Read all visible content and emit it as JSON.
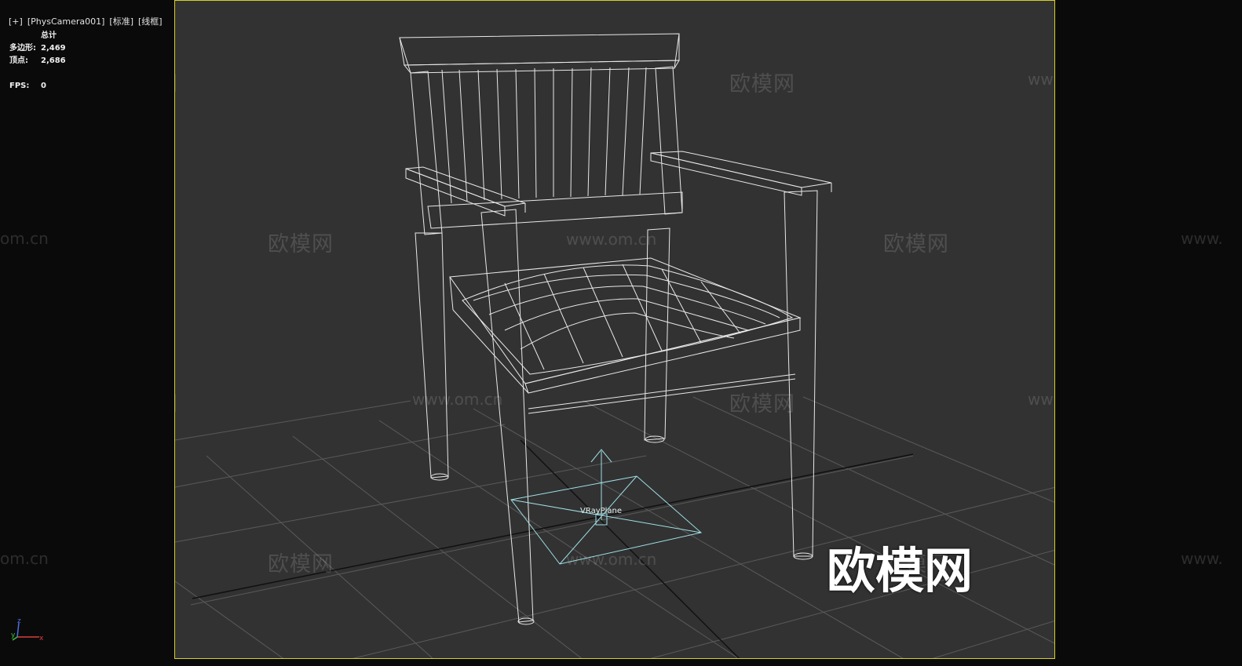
{
  "viewport_label": [
    "[+]",
    "[PhysCamera001]",
    "[标准]",
    "[线框]"
  ],
  "stats": {
    "header": "总计",
    "polygons_label": "多边形:",
    "polygons": "2,469",
    "vertices_label": "顶点:",
    "vertices": "2,686",
    "fps_label": "FPS:",
    "fps": "0"
  },
  "scene": {
    "object_label": "VRayPlane",
    "helper_color": "#9fe0e6",
    "wire_color": "#e8e8e8",
    "grid_color": "#5a5a5a",
    "viewport_border_color": "#d6cf25"
  },
  "axis": {
    "x": "x",
    "y": "y",
    "z": "z"
  },
  "watermarks": {
    "cn": "欧模网",
    "url": "www.om.cn",
    "url_partial_left": "om.cn",
    "url_partial_right": "www."
  }
}
